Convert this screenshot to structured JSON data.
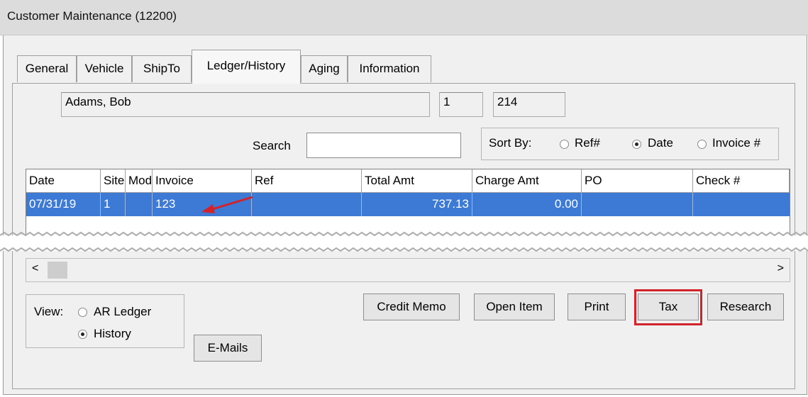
{
  "window": {
    "title": "Customer Maintenance (12200)"
  },
  "tabs": [
    {
      "label": "General"
    },
    {
      "label": "Vehicle"
    },
    {
      "label": "ShipTo"
    },
    {
      "label": "Ledger/History",
      "active": true
    },
    {
      "label": "Aging"
    },
    {
      "label": "Information"
    }
  ],
  "customer": {
    "name": "Adams, Bob",
    "site": "1",
    "number": "214"
  },
  "search": {
    "label": "Search",
    "value": ""
  },
  "sort": {
    "label": "Sort By:",
    "options": [
      {
        "label": "Ref#",
        "selected": false
      },
      {
        "label": "Date",
        "selected": true
      },
      {
        "label": "Invoice #",
        "selected": false
      }
    ]
  },
  "grid": {
    "columns": [
      "Date",
      "Site",
      "Mod",
      "Invoice",
      "Ref",
      "Total Amt",
      "Charge Amt",
      "PO",
      "Check #"
    ],
    "rows": [
      {
        "Date": "07/31/19",
        "Site": "1",
        "Mod": "",
        "Invoice": "123",
        "Ref": "",
        "Total Amt": "737.13",
        "Charge Amt": "0.00",
        "PO": "",
        "Check #": ""
      }
    ],
    "selected_color": "#3d7ad6"
  },
  "view": {
    "label": "View:",
    "options": [
      {
        "label": "AR Ledger",
        "selected": false
      },
      {
        "label": "History",
        "selected": true
      }
    ]
  },
  "buttons": {
    "credit_memo": "Credit Memo",
    "open_item": "Open Item",
    "print": "Print",
    "tax": "Tax",
    "research": "Research",
    "emails": "E-Mails"
  },
  "annotation": {
    "highlight_color": "#d2232a",
    "arrow_color": "#d2232a"
  }
}
